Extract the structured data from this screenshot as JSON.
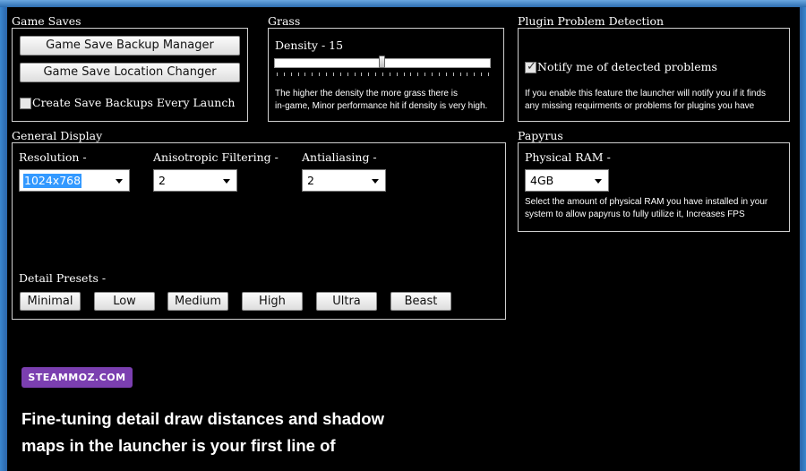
{
  "game_saves": {
    "title": "Game Saves",
    "backup_manager_label": "Game Save Backup Manager",
    "location_changer_label": "Game Save Location Changer",
    "create_backups_label": "Create Save Backups Every Launch",
    "create_backups_checked": false
  },
  "grass": {
    "title": "Grass",
    "density_label": "Density - 15",
    "density_value": 15,
    "density_fraction": 0.5,
    "description_line1": "The higher the density the more grass there is",
    "description_line2": "in-game, Minor performance hit if density is very high."
  },
  "plugin": {
    "title": "Plugin Problem Detection",
    "notify_label": "Notify me of detected problems",
    "notify_checked": true,
    "description_line1": "If you enable this feature the launcher will notify you if it finds",
    "description_line2": "any missing requirments or problems for plugins you have"
  },
  "general_display": {
    "title": "General Display",
    "resolution_label": "Resolution -",
    "resolution_value": "1024x768",
    "anisotropic_label": "Anisotropic Filtering -",
    "anisotropic_value": "2",
    "antialiasing_label": "Antialiasing -",
    "antialiasing_value": "2",
    "presets_label": "Detail Presets -",
    "presets": [
      "Minimal",
      "Low",
      "Medium",
      "High",
      "Ultra",
      "Beast"
    ]
  },
  "papyrus": {
    "title": "Papyrus",
    "ram_label": "Physical RAM -",
    "ram_value": "4GB",
    "description_line1": "Select the amount of physical RAM you have installed in your",
    "description_line2": "system to allow papyrus to fully utilize it, Increases FPS"
  },
  "overlay": {
    "badge": "STEAMMOZ.COM",
    "caption_line1": "Fine-tuning detail draw distances and shadow",
    "caption_line2": "maps in the launcher is your first line of"
  },
  "colors": {
    "background": "#000000",
    "badge": "#7b3fb0",
    "selection": "#3399ff",
    "frame": "#2b6fb5"
  }
}
